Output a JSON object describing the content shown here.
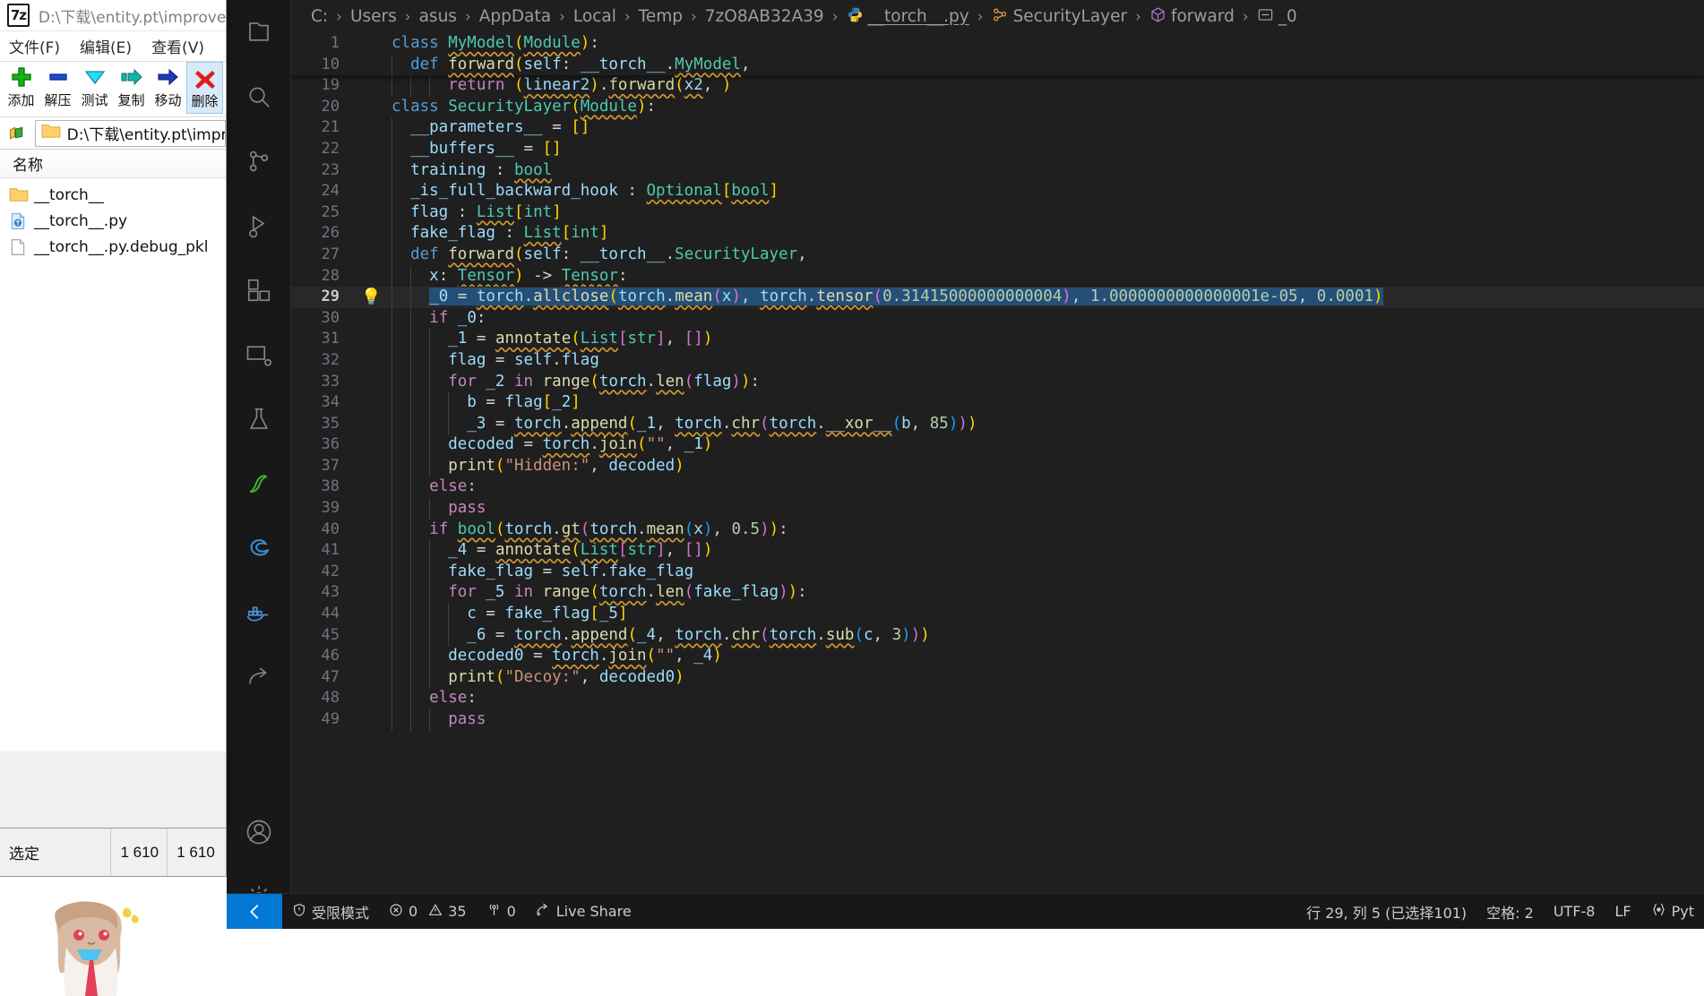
{
  "sevenzip": {
    "logo": "7z",
    "title": "D:\\下载\\entity.pt\\improved",
    "menu": [
      "文件(F)",
      "编辑(E)",
      "查看(V)"
    ],
    "toolbar": [
      {
        "label": "添加",
        "icon": "plus-green-icon"
      },
      {
        "label": "解压",
        "icon": "minus-blue-icon"
      },
      {
        "label": "测试",
        "icon": "check-cyan-icon"
      },
      {
        "label": "复制",
        "icon": "copy-arrow-icon"
      },
      {
        "label": "移动",
        "icon": "move-arrow-icon"
      },
      {
        "label": "删除",
        "icon": "delete-x-icon"
      }
    ],
    "address": "D:\\下载\\entity.pt\\impr",
    "column_header": "名称",
    "files": [
      {
        "name": "__torch__",
        "type": "folder"
      },
      {
        "name": "__torch__.py",
        "type": "python"
      },
      {
        "name": "__torch__.py.debug_pkl",
        "type": "file"
      }
    ],
    "status": {
      "label": "选定",
      "size": "1 610",
      "total": "1 610"
    }
  },
  "vscode": {
    "activitybar": [
      {
        "name": "explorer-icon"
      },
      {
        "name": "search-icon"
      },
      {
        "name": "source-control-icon"
      },
      {
        "name": "run-debug-icon"
      },
      {
        "name": "extensions-icon"
      },
      {
        "name": "remote-explorer-icon"
      },
      {
        "name": "testing-icon"
      },
      {
        "name": "anaconda-icon"
      },
      {
        "name": "edge-tools-icon"
      },
      {
        "name": "docker-icon"
      },
      {
        "name": "share-icon"
      },
      {
        "name": "account-icon"
      },
      {
        "name": "settings-gear-icon"
      }
    ],
    "breadcrumb": [
      {
        "label": "C:",
        "icon": ""
      },
      {
        "label": "Users",
        "icon": ""
      },
      {
        "label": "asus",
        "icon": ""
      },
      {
        "label": "AppData",
        "icon": ""
      },
      {
        "label": "Local",
        "icon": ""
      },
      {
        "label": "Temp",
        "icon": ""
      },
      {
        "label": "7zO8AB32A39",
        "icon": ""
      },
      {
        "label": "__torch__.py",
        "icon": "python-icon"
      },
      {
        "label": "SecurityLayer",
        "icon": "class-icon"
      },
      {
        "label": "forward",
        "icon": "method-icon"
      },
      {
        "label": "_0",
        "icon": "variable-icon"
      }
    ],
    "sticky_lines": [
      {
        "num": "1",
        "text": "class MyModel(Module):"
      },
      {
        "num": "10",
        "text": "  def forward(self: __torch__.MyModel,"
      }
    ],
    "code_lines": [
      {
        "num": "19",
        "text": "      return (linear2).forward(x2, )"
      },
      {
        "num": "20",
        "text": "class SecurityLayer(Module):"
      },
      {
        "num": "21",
        "text": "  __parameters__ = []"
      },
      {
        "num": "22",
        "text": "  __buffers__ = []"
      },
      {
        "num": "23",
        "text": "  training : bool"
      },
      {
        "num": "24",
        "text": "  _is_full_backward_hook : Optional[bool]"
      },
      {
        "num": "25",
        "text": "  flag : List[int]"
      },
      {
        "num": "26",
        "text": "  fake_flag : List[int]"
      },
      {
        "num": "27",
        "text": "  def forward(self: __torch__.SecurityLayer,"
      },
      {
        "num": "28",
        "text": "    x: Tensor) -> Tensor:"
      },
      {
        "num": "29",
        "text": "    _0 = torch.allclose(torch.mean(x), torch.tensor(0.31415000000000004), 1.0000000000000001e-05, 0.0001)"
      },
      {
        "num": "30",
        "text": "    if _0:"
      },
      {
        "num": "31",
        "text": "      _1 = annotate(List[str], [])"
      },
      {
        "num": "32",
        "text": "      flag = self.flag"
      },
      {
        "num": "33",
        "text": "      for _2 in range(torch.len(flag)):"
      },
      {
        "num": "34",
        "text": "        b = flag[_2]"
      },
      {
        "num": "35",
        "text": "        _3 = torch.append(_1, torch.chr(torch.__xor__(b, 85)))"
      },
      {
        "num": "36",
        "text": "      decoded = torch.join(\"\", _1)"
      },
      {
        "num": "37",
        "text": "      print(\"Hidden:\", decoded)"
      },
      {
        "num": "38",
        "text": "    else:"
      },
      {
        "num": "39",
        "text": "      pass"
      },
      {
        "num": "40",
        "text": "    if bool(torch.gt(torch.mean(x), 0.5)):"
      },
      {
        "num": "41",
        "text": "      _4 = annotate(List[str], [])"
      },
      {
        "num": "42",
        "text": "      fake_flag = self.fake_flag"
      },
      {
        "num": "43",
        "text": "      for _5 in range(torch.len(fake_flag)):"
      },
      {
        "num": "44",
        "text": "        c = fake_flag[_5]"
      },
      {
        "num": "45",
        "text": "        _6 = torch.append(_4, torch.chr(torch.sub(c, 3)))"
      },
      {
        "num": "46",
        "text": "      decoded0 = torch.join(\"\", _4)"
      },
      {
        "num": "47",
        "text": "      print(\"Decoy:\", decoded0)"
      },
      {
        "num": "48",
        "text": "    else:"
      },
      {
        "num": "49",
        "text": "      pass"
      }
    ],
    "current_line": "29",
    "statusbar": {
      "remote_icon": "remote-window-icon",
      "restricted_mode": "受限模式",
      "errors": "0",
      "warnings": "35",
      "ports": "0",
      "live_share": "Live Share",
      "cursor_position": "行 29, 列 5 (已选择101)",
      "indentation": "空格: 2",
      "encoding": "UTF-8",
      "eol": "LF",
      "language": "Pyt"
    }
  },
  "colors": {
    "accent": "#0078d4",
    "editor_bg": "#1f1f1f",
    "selection": "#264f78",
    "sidebar_bg": "#181818"
  }
}
